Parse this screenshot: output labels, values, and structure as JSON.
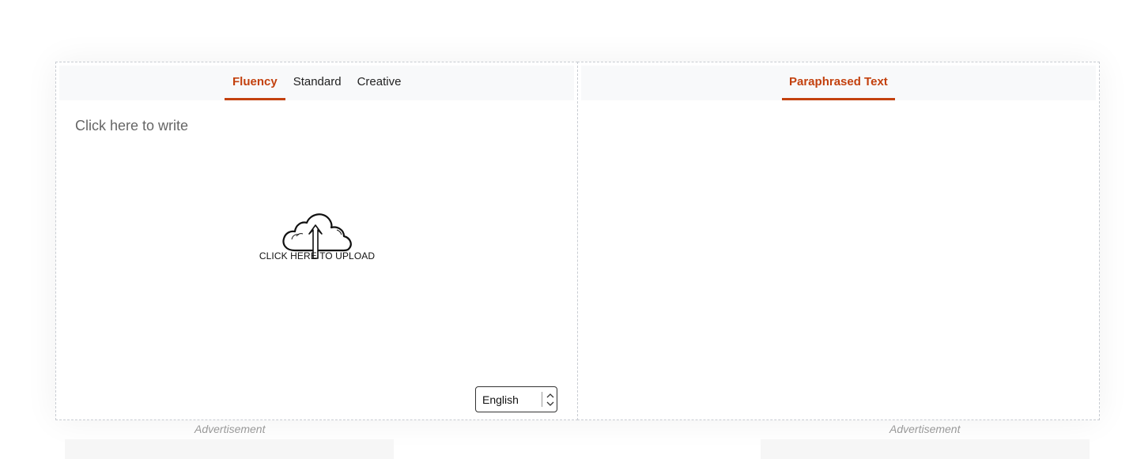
{
  "input_panel": {
    "tabs": [
      {
        "label": "Fluency",
        "active": true
      },
      {
        "label": "Standard",
        "active": false
      },
      {
        "label": "Creative",
        "active": false
      }
    ],
    "editor_placeholder": "Click here to write",
    "upload_label": "CLICK HERE TO UPLOAD",
    "upload_icon": "cloud-upload-icon",
    "language": "English"
  },
  "output_panel": {
    "tabs": [
      {
        "label": "Paraphrased Text",
        "active": true
      }
    ]
  },
  "ads": {
    "left_label": "Advertisement",
    "right_label": "Advertisement"
  },
  "colors": {
    "accent": "#c3410e",
    "tabbar_bg": "#f8f9fa",
    "border": "#c8ccd2"
  }
}
